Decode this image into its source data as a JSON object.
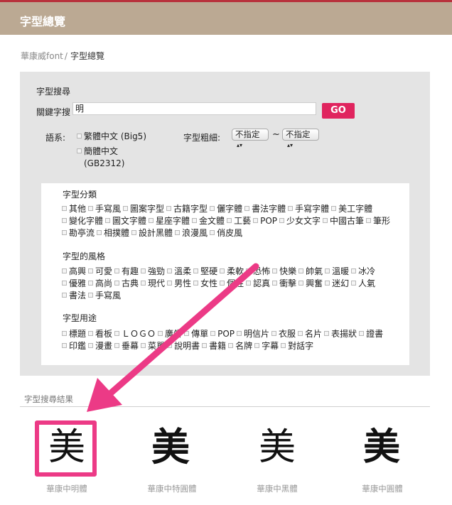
{
  "header": {
    "title": "字型總覽"
  },
  "breadcrumb": {
    "home": "華康威font",
    "separator": "/",
    "current": "字型總覽"
  },
  "search": {
    "section_title": "字型搜尋",
    "keyword_label": "關鍵字搜",
    "keyword_value": "明",
    "go_label": "GO",
    "lang_label": "語系:",
    "lang_options": [
      "繁體中文 (Big5)",
      "簡體中文",
      "(GB2312)"
    ],
    "weight_label": "字型粗細:",
    "weight_from": "不指定",
    "weight_to": "不指定",
    "range_sep": "~"
  },
  "categories": {
    "title": "字型分類",
    "items": [
      "其他",
      "手寫風",
      "圖案字型",
      "古籍字型",
      "儷字體",
      "書法字體",
      "手寫字體",
      "美工字體",
      "變化字體",
      "圖文字體",
      "星座字體",
      "金文體",
      "工藝",
      "POP",
      "少女文字",
      "中國古筆",
      "筆形",
      "勘亭流",
      "相撲體",
      "設計黑體",
      "浪漫風",
      "俏皮風"
    ]
  },
  "styles": {
    "title": "字型的風格",
    "items": [
      "高興",
      "可愛",
      "有趣",
      "強勁",
      "溫柔",
      "堅硬",
      "柔軟",
      "恐怖",
      "快樂",
      "帥氣",
      "溫暖",
      "冰冷",
      "優雅",
      "高尚",
      "古典",
      "現代",
      "男性",
      "女性",
      "個性",
      "認真",
      "衝擊",
      "興奮",
      "迷幻",
      "人氣",
      "書法",
      "手寫風"
    ]
  },
  "usage": {
    "title": "字型用途",
    "items": [
      "標題",
      "看板",
      "ＬＯＧＯ",
      "廣告",
      "傳單",
      "POP",
      "明信片",
      "衣服",
      "名片",
      "表揚狀",
      "證書",
      "印鑑",
      "漫畫",
      "垂幕",
      "菜單",
      "說明書",
      "書籍",
      "名牌",
      "字幕",
      "對話字"
    ]
  },
  "results": {
    "title": "字型搜尋結果",
    "fonts": [
      {
        "glyph": "美",
        "name": "華康中明體"
      },
      {
        "glyph": "美",
        "name": "華康中特圓體"
      },
      {
        "glyph": "美",
        "name": "華康中黑體"
      },
      {
        "glyph": "美",
        "name": "華康中圓體"
      }
    ]
  },
  "colors": {
    "header_bg": "#bba993",
    "top_line": "#b8323c",
    "go_button": "#e0245e",
    "annotation": "#ec3a86",
    "panel_bg": "#e4e4e4"
  }
}
